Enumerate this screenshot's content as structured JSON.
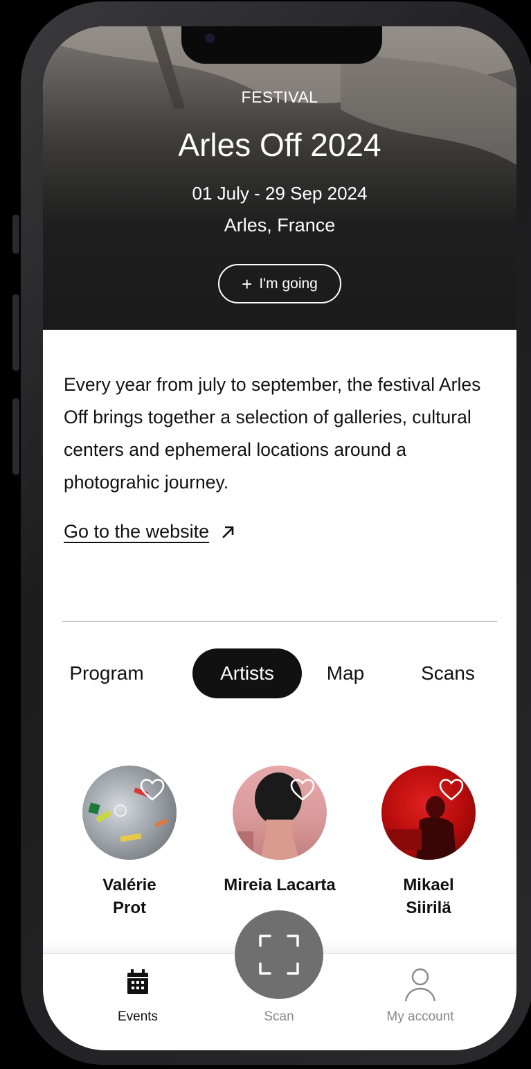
{
  "event": {
    "label": "FESTIVAL",
    "title": "Arles Off 2024",
    "dates": "01 July - 29 Sep 2024",
    "location": "Arles, France",
    "going_button": "I'm going",
    "description": "Every year from july to september, the festival Arles Off brings together a selection of galleries, cultural centers and ephemeral locations around a photograhic journey.",
    "website_link": "Go to the website"
  },
  "tabs": [
    {
      "label": "Program",
      "active": false
    },
    {
      "label": "Artists",
      "active": true
    },
    {
      "label": "Map",
      "active": false
    },
    {
      "label": "Scans",
      "active": false
    }
  ],
  "artists": [
    {
      "name": "Valérie Prot",
      "favorited": false
    },
    {
      "name": "Mireia Lacarta",
      "favorited": false
    },
    {
      "name": "Mikael Siirilä",
      "favorited": false
    }
  ],
  "bottom_nav": [
    {
      "label": "Events",
      "icon": "calendar-icon",
      "active": true
    },
    {
      "label": "Scan",
      "icon": "scan-frame-icon",
      "active": false
    },
    {
      "label": "My account",
      "icon": "user-icon",
      "active": false
    }
  ],
  "colors": {
    "text": "#111111",
    "inactive_nav": "#888888",
    "scan_button": "#6f6f6f",
    "active_tab": "#111111"
  }
}
